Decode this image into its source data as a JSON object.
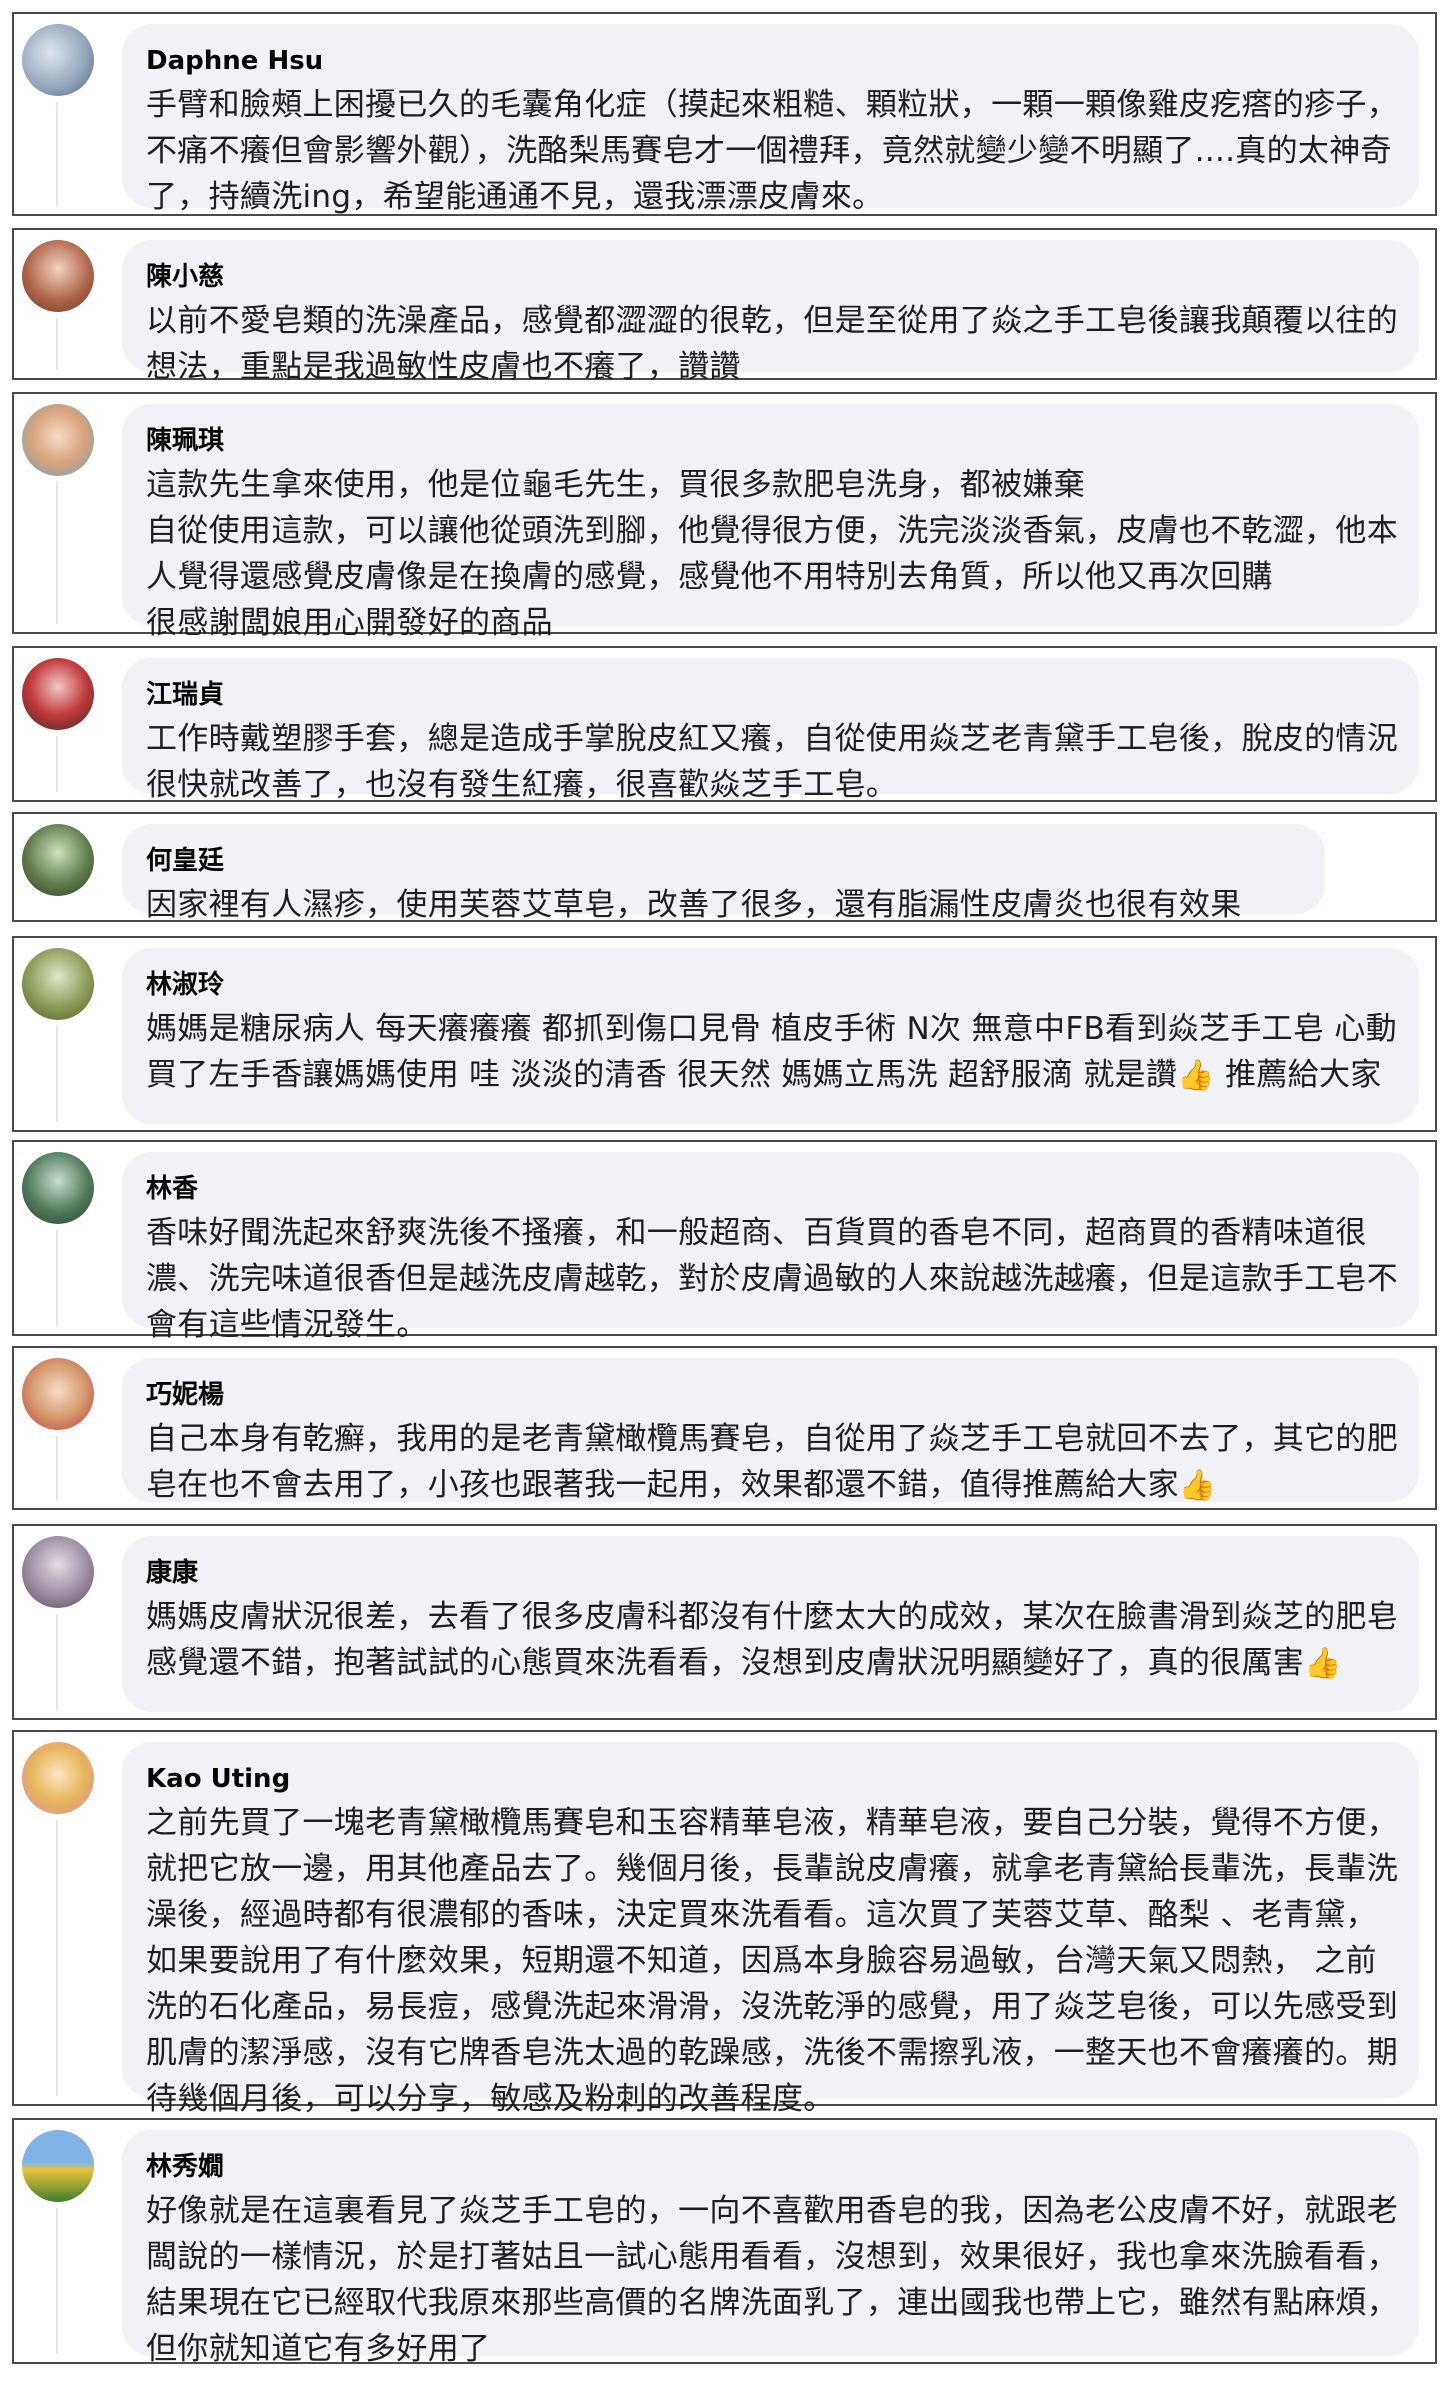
{
  "comments": [
    {
      "name": "Daphne Hsu",
      "text": "手臂和臉頰上困擾已久的毛囊角化症（摸起來粗糙、顆粒狀，一顆一顆像雞皮疙瘩的疹子，不痛不癢但會影響外觀），洗酪梨馬賽皂才一個禮拜，竟然就變少變不明顯了....真的太神奇了，持續洗ing，希望能通通不見，還我漂漂皮膚來。"
    },
    {
      "name": "陳小慈",
      "text": "以前不愛皂類的洗澡產品，感覺都澀澀的很乾，但是至從用了焱之手工皂後讓我顛覆以往的想法，重點是我過敏性皮膚也不癢了，讚讚"
    },
    {
      "name": "陳珮琪",
      "text": "這款先生拿來使用，他是位龜毛先生，買很多款肥皂洗身，都被嫌棄\n自從使用這款，可以讓他從頭洗到腳，他覺得很方便，洗完淡淡香氣，皮膚也不乾澀，他本人覺得還感覺皮膚像是在換膚的感覺，感覺他不用特別去角質，所以他又再次回購\n很感謝闆娘用心開發好的商品"
    },
    {
      "name": "江瑞貞",
      "text": "工作時戴塑膠手套，總是造成手掌脫皮紅又癢，自從使用焱芝老青黛手工皂後，脫皮的情況很快就改善了，也沒有發生紅癢，很喜歡焱芝手工皂。"
    },
    {
      "name": "何皇廷",
      "text": "因家裡有人濕疹，使用芙蓉艾草皂，改善了很多，還有脂漏性皮膚炎也很有效果"
    },
    {
      "name": "林淑玲",
      "text": "媽媽是糖尿病人 每天癢癢癢 都抓到傷口見骨 植皮手術 N次 無意中FB看到焱芝手工皂 心動 買了左手香讓媽媽使用 哇 淡淡的清香 很天然 媽媽立馬洗 超舒服滴 就是讚",
      "text_after": " 推薦給大家"
    },
    {
      "name": "林香",
      "text": "香味好聞洗起來舒爽洗後不搔癢，和一般超商、百貨買的香皂不同，超商買的香精味道很濃、洗完味道很香但是越洗皮膚越乾，對於皮膚過敏的人來說越洗越癢，但是這款手工皂不會有這些情況發生。"
    },
    {
      "name": "巧妮楊",
      "text": "自己本身有乾癬，我用的是老青黛橄欖馬賽皂，自從用了焱芝手工皂就回不去了，其它的肥皂在也不會去用了，小孩也跟著我一起用，效果都還不錯，值得推薦給大家"
    },
    {
      "name": "康康",
      "text": "媽媽皮膚狀況很差，去看了很多皮膚科都沒有什麼太大的成效，某次在臉書滑到焱芝的肥皂感覺還不錯，抱著試試的心態買來洗看看，沒想到皮膚狀況明顯變好了，真的很厲害"
    },
    {
      "name": "Kao Uting",
      "text": "之前先買了一塊老青黛橄欖馬賽皂和玉容精華皂液，精華皂液，要自己分裝，覺得不方便，就把它放一邊，用其他產品去了。幾個月後，長輩說皮膚癢，就拿老青黛給長輩洗，長輩洗澡後，經過時都有很濃郁的香味，決定買來洗看看。這次買了芙蓉艾草、酪梨 、老青黛，如果要說用了有什麼效果，短期還不知道，因爲本身臉容易過敏，台灣天氣又悶熱， 之前洗的石化產品，易長痘，感覺洗起來滑滑，沒洗乾淨的感覺，用了焱芝皂後，可以先感受到肌膚的潔淨感，沒有它牌香皂洗太過的乾躁感，洗後不需擦乳液，一整天也不會癢癢的。期待幾個月後，可以分享，敏感及粉刺的改善程度。"
    },
    {
      "name": "林秀嫺",
      "text": "好像就是在這裏看見了焱芝手工皂的，一向不喜歡用香皂的我，因為老公皮膚不好，就跟老闆說的一樣情況，於是打著姑且一試心態用看看，沒想到，效果很好，我也拿來洗臉看看，結果現在它已經取代我原來那些高價的名牌洗面乳了，連出國我也帶上它，雖然有點麻煩，但你就知道它有多好用了"
    }
  ],
  "icons": {
    "thumbs_up": "👍"
  }
}
